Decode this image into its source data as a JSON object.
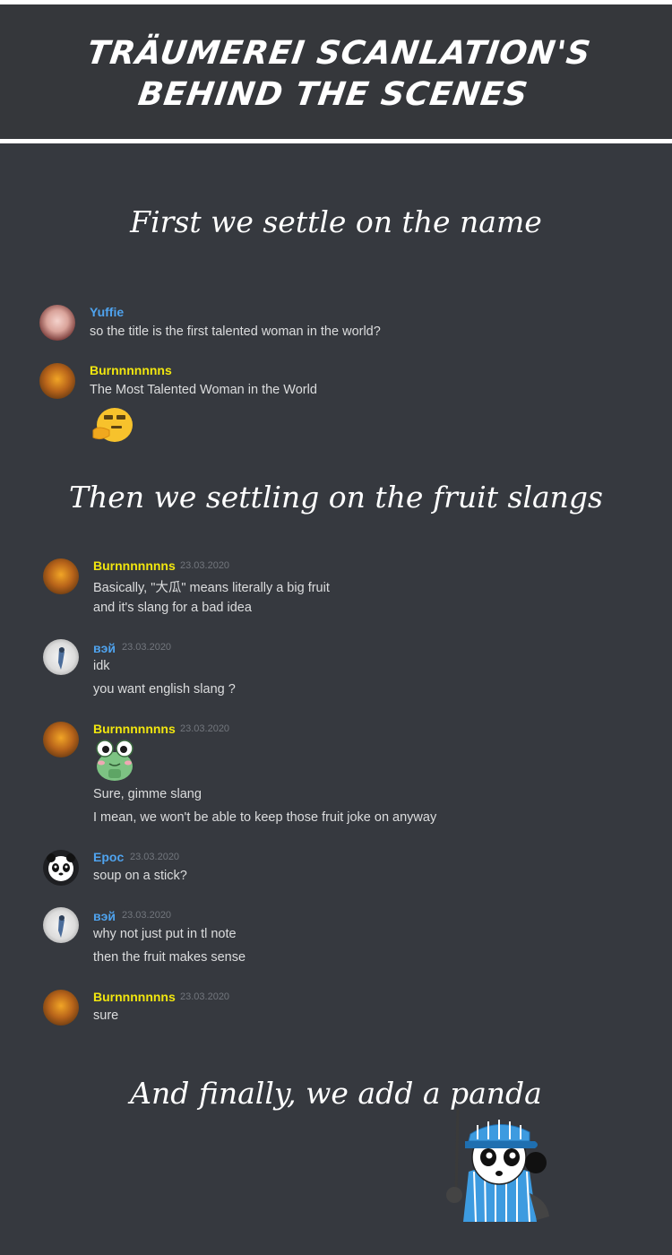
{
  "header": {
    "title_line1": "TRÄUMEREI SCANLATION'S",
    "title_line2": "BEHIND THE SCENES"
  },
  "captions": {
    "name": "First we settle on the name",
    "fruit": "Then we settling on the fruit slangs",
    "panda": "And finally, we add a panda"
  },
  "chat1": [
    {
      "user": "Yuffie",
      "color": "#4fa3ee",
      "timestamp": "",
      "lines": [
        "so the title is the first talented woman in the world?"
      ]
    },
    {
      "user": "Burnnnnnnns",
      "color": "#f1e60f",
      "timestamp": "",
      "lines": [
        "The Most Talented Woman in the World"
      ],
      "emoji": "thinking-blob-emoji"
    }
  ],
  "chat2": [
    {
      "user": "Burnnnnnnns",
      "timestamp": "23.03.2020",
      "lines": [
        "Basically, \"大瓜\" means literally a big fruit",
        "and it's slang for a bad idea"
      ]
    },
    {
      "user": "вэй",
      "timestamp": "23.03.2020",
      "lines": [
        "idk",
        "you want english slang ?"
      ]
    },
    {
      "user": "Burnnnnnnns",
      "timestamp": "23.03.2020",
      "lines": [
        "Sure, gimme slang",
        "I mean, we won't be able to keep those fruit joke on anyway"
      ],
      "emoji": "frog-emoji"
    },
    {
      "user": "Epoc",
      "timestamp": "23.03.2020",
      "lines": [
        "soup on a stick?"
      ]
    },
    {
      "user": "вэй",
      "timestamp": "23.03.2020",
      "lines": [
        "why not just put in tl note",
        "then the fruit makes sense"
      ]
    },
    {
      "user": "Burnnnnnnns",
      "timestamp": "23.03.2020",
      "lines": [
        "sure"
      ]
    }
  ],
  "colors": {
    "background": "#36393f",
    "header": "#35373b",
    "yellow": "#f1e60f",
    "blue": "#4fa3ee",
    "text": "#dcddde",
    "timestamp": "#72767d"
  }
}
